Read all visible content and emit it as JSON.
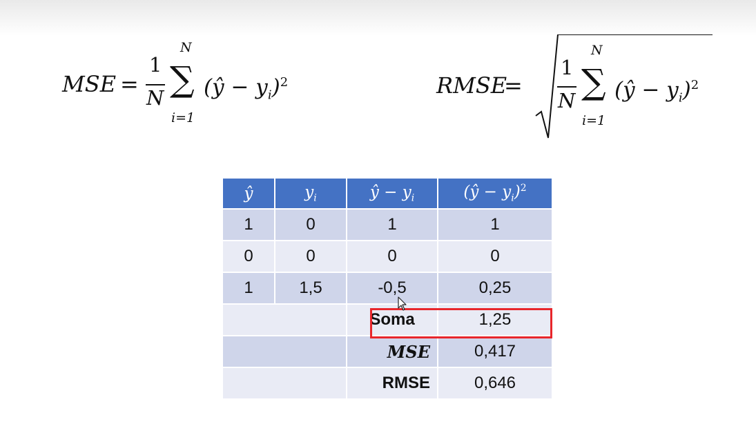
{
  "formulas": {
    "mse": {
      "lhs": "MSE",
      "eq": "=",
      "numerator": "1",
      "denominator": "N",
      "sum_upper": "N",
      "sum_lower": "i=1"
    },
    "rmse": {
      "lhs": "RMSE",
      "eq": "=",
      "numerator": "1",
      "denominator": "N",
      "sum_upper": "N",
      "sum_lower": "i=1"
    }
  },
  "table": {
    "headers": [
      "ŷ",
      "yi",
      "ŷ − yi",
      "(ŷ − yi)²"
    ],
    "rows": [
      [
        "1",
        "0",
        "1",
        "1"
      ],
      [
        "0",
        "0",
        "0",
        "0"
      ],
      [
        "1",
        "1,5",
        "-0,5",
        "0,25"
      ]
    ],
    "summary": [
      {
        "label": "Soma",
        "value": "1,25"
      },
      {
        "label": "MSE",
        "value": "0,417"
      },
      {
        "label": "RMSE",
        "value": "0,646"
      }
    ]
  },
  "colors": {
    "header": "#4472c4",
    "row_dark": "#cfd5ea",
    "row_light": "#e9ebf5",
    "highlight": "#e8262b"
  },
  "icons": {
    "cursor": "mouse-pointer-icon"
  }
}
